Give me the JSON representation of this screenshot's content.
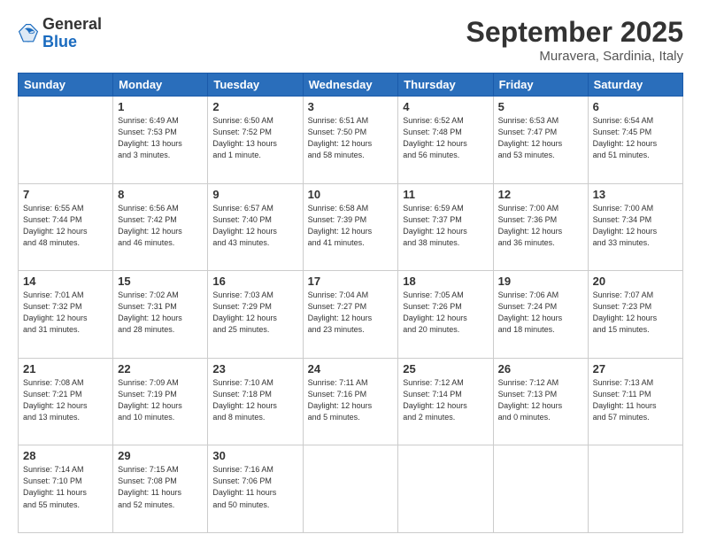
{
  "header": {
    "logo_line1": "General",
    "logo_line2": "Blue",
    "month": "September 2025",
    "location": "Muravera, Sardinia, Italy"
  },
  "weekdays": [
    "Sunday",
    "Monday",
    "Tuesday",
    "Wednesday",
    "Thursday",
    "Friday",
    "Saturday"
  ],
  "weeks": [
    [
      {
        "day": "",
        "info": ""
      },
      {
        "day": "1",
        "info": "Sunrise: 6:49 AM\nSunset: 7:53 PM\nDaylight: 13 hours\nand 3 minutes."
      },
      {
        "day": "2",
        "info": "Sunrise: 6:50 AM\nSunset: 7:52 PM\nDaylight: 13 hours\nand 1 minute."
      },
      {
        "day": "3",
        "info": "Sunrise: 6:51 AM\nSunset: 7:50 PM\nDaylight: 12 hours\nand 58 minutes."
      },
      {
        "day": "4",
        "info": "Sunrise: 6:52 AM\nSunset: 7:48 PM\nDaylight: 12 hours\nand 56 minutes."
      },
      {
        "day": "5",
        "info": "Sunrise: 6:53 AM\nSunset: 7:47 PM\nDaylight: 12 hours\nand 53 minutes."
      },
      {
        "day": "6",
        "info": "Sunrise: 6:54 AM\nSunset: 7:45 PM\nDaylight: 12 hours\nand 51 minutes."
      }
    ],
    [
      {
        "day": "7",
        "info": "Sunrise: 6:55 AM\nSunset: 7:44 PM\nDaylight: 12 hours\nand 48 minutes."
      },
      {
        "day": "8",
        "info": "Sunrise: 6:56 AM\nSunset: 7:42 PM\nDaylight: 12 hours\nand 46 minutes."
      },
      {
        "day": "9",
        "info": "Sunrise: 6:57 AM\nSunset: 7:40 PM\nDaylight: 12 hours\nand 43 minutes."
      },
      {
        "day": "10",
        "info": "Sunrise: 6:58 AM\nSunset: 7:39 PM\nDaylight: 12 hours\nand 41 minutes."
      },
      {
        "day": "11",
        "info": "Sunrise: 6:59 AM\nSunset: 7:37 PM\nDaylight: 12 hours\nand 38 minutes."
      },
      {
        "day": "12",
        "info": "Sunrise: 7:00 AM\nSunset: 7:36 PM\nDaylight: 12 hours\nand 36 minutes."
      },
      {
        "day": "13",
        "info": "Sunrise: 7:00 AM\nSunset: 7:34 PM\nDaylight: 12 hours\nand 33 minutes."
      }
    ],
    [
      {
        "day": "14",
        "info": "Sunrise: 7:01 AM\nSunset: 7:32 PM\nDaylight: 12 hours\nand 31 minutes."
      },
      {
        "day": "15",
        "info": "Sunrise: 7:02 AM\nSunset: 7:31 PM\nDaylight: 12 hours\nand 28 minutes."
      },
      {
        "day": "16",
        "info": "Sunrise: 7:03 AM\nSunset: 7:29 PM\nDaylight: 12 hours\nand 25 minutes."
      },
      {
        "day": "17",
        "info": "Sunrise: 7:04 AM\nSunset: 7:27 PM\nDaylight: 12 hours\nand 23 minutes."
      },
      {
        "day": "18",
        "info": "Sunrise: 7:05 AM\nSunset: 7:26 PM\nDaylight: 12 hours\nand 20 minutes."
      },
      {
        "day": "19",
        "info": "Sunrise: 7:06 AM\nSunset: 7:24 PM\nDaylight: 12 hours\nand 18 minutes."
      },
      {
        "day": "20",
        "info": "Sunrise: 7:07 AM\nSunset: 7:23 PM\nDaylight: 12 hours\nand 15 minutes."
      }
    ],
    [
      {
        "day": "21",
        "info": "Sunrise: 7:08 AM\nSunset: 7:21 PM\nDaylight: 12 hours\nand 13 minutes."
      },
      {
        "day": "22",
        "info": "Sunrise: 7:09 AM\nSunset: 7:19 PM\nDaylight: 12 hours\nand 10 minutes."
      },
      {
        "day": "23",
        "info": "Sunrise: 7:10 AM\nSunset: 7:18 PM\nDaylight: 12 hours\nand 8 minutes."
      },
      {
        "day": "24",
        "info": "Sunrise: 7:11 AM\nSunset: 7:16 PM\nDaylight: 12 hours\nand 5 minutes."
      },
      {
        "day": "25",
        "info": "Sunrise: 7:12 AM\nSunset: 7:14 PM\nDaylight: 12 hours\nand 2 minutes."
      },
      {
        "day": "26",
        "info": "Sunrise: 7:12 AM\nSunset: 7:13 PM\nDaylight: 12 hours\nand 0 minutes."
      },
      {
        "day": "27",
        "info": "Sunrise: 7:13 AM\nSunset: 7:11 PM\nDaylight: 11 hours\nand 57 minutes."
      }
    ],
    [
      {
        "day": "28",
        "info": "Sunrise: 7:14 AM\nSunset: 7:10 PM\nDaylight: 11 hours\nand 55 minutes."
      },
      {
        "day": "29",
        "info": "Sunrise: 7:15 AM\nSunset: 7:08 PM\nDaylight: 11 hours\nand 52 minutes."
      },
      {
        "day": "30",
        "info": "Sunrise: 7:16 AM\nSunset: 7:06 PM\nDaylight: 11 hours\nand 50 minutes."
      },
      {
        "day": "",
        "info": ""
      },
      {
        "day": "",
        "info": ""
      },
      {
        "day": "",
        "info": ""
      },
      {
        "day": "",
        "info": ""
      }
    ]
  ]
}
